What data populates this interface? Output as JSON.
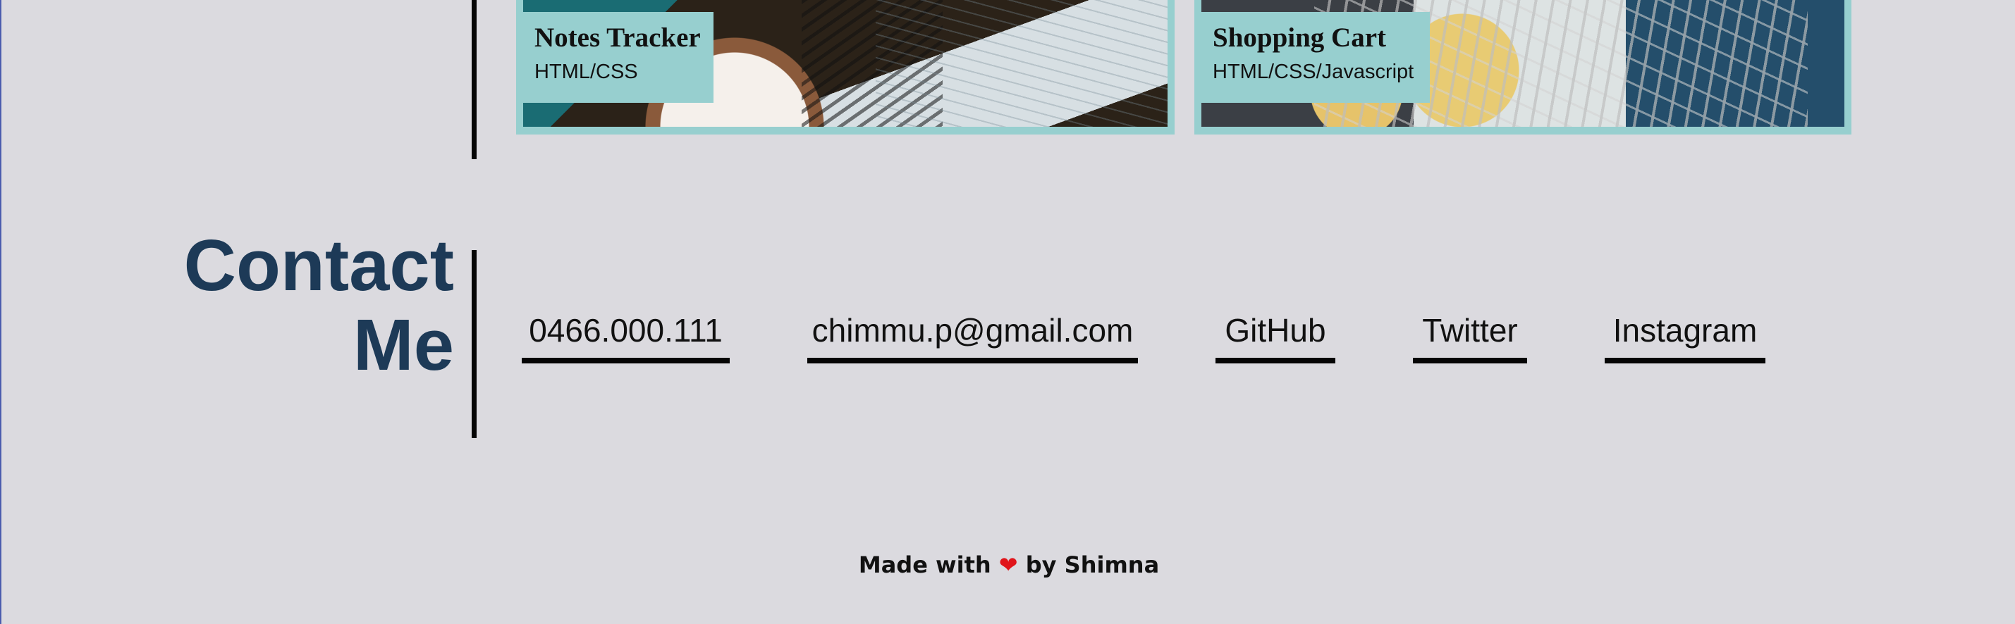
{
  "projects": [
    {
      "title": "Notes Tracker",
      "tech": "HTML/CSS"
    },
    {
      "title": "Shopping Cart",
      "tech": "HTML/CSS/Javascript"
    }
  ],
  "contact": {
    "title_line1": "Contact",
    "title_line2": "Me",
    "links": {
      "phone": "0466.000.111",
      "email": "chimmu.p@gmail.com",
      "github": "GitHub",
      "twitter": "Twitter",
      "instagram": "Instagram"
    }
  },
  "footer": {
    "made_with": "Made with",
    "heart": "❤",
    "by": "by Shimna"
  },
  "colors": {
    "background": "#dbdadf",
    "card_accent": "#97cfcf",
    "heading": "#1d3a57",
    "text": "#111111",
    "heart": "#e0141a"
  },
  "icons": {
    "heart": "heart-icon"
  }
}
